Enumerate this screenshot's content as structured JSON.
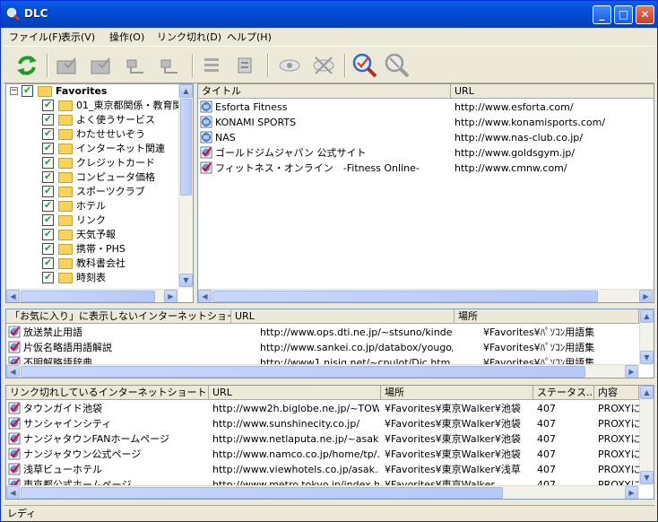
{
  "window": {
    "title": "DLC"
  },
  "menu": [
    "ファイル(F)",
    "表示(V)",
    "操作(O)",
    "リンク切れ(D)",
    "ヘルプ(H)"
  ],
  "tree": {
    "root": "Favorites",
    "items": [
      "01_東京都関係・教育関",
      "よく使うサービス",
      "わたせせいぞう",
      "インターネット関連",
      "クレジットカード",
      "コンピュータ価格",
      "スポーツクラブ",
      "ホテル",
      "リンク",
      "天気予報",
      "携帯・PHS",
      "教科書会社",
      "時刻表"
    ]
  },
  "list1": {
    "headers": [
      "タイトル",
      "URL"
    ],
    "rows": [
      [
        "Esforta Fitness",
        "http://www.esforta.com/"
      ],
      [
        "KONAMI SPORTS",
        "http://www.konamisports.com/"
      ],
      [
        "NAS",
        "http://www.nas-club.co.jp/"
      ],
      [
        "ゴールドジムジャパン 公式サイト",
        "http://www.goldsgym.jp/"
      ],
      [
        "フィットネス・オンライン　-Fitness Online-",
        "http://www.cmnw.com/"
      ]
    ]
  },
  "list2": {
    "headers": [
      "「お気に入り」に表示しないインターネットショートカ...",
      "URL",
      "場所"
    ],
    "rows": [
      [
        "放送禁止用語",
        "http://www.ops.dti.ne.jp/~stsuno/kindex.html",
        "¥Favorites¥ﾊﾟｿｺﾝ用語集"
      ],
      [
        "片仮名略語用語解説",
        "http://www.sankei.co.jp/databox/yougo/ryak...",
        "¥Favorites¥ﾊﾟｿｺﾝ用語集"
      ],
      [
        "不明解略語辞典",
        "http://www1.nisiq.net/~cpulot/Dic.htm",
        "¥Favorites¥ﾊﾟｿｺﾝ用語集"
      ]
    ]
  },
  "list3": {
    "headers": [
      "リンク切れしているインターネットショートカット",
      "URL",
      "場所",
      "ステータス...",
      "内容"
    ],
    "rows": [
      [
        "タウンガイド池袋",
        "http://www2h.biglobe.ne.jp/~TOW...",
        "¥Favorites¥東京Walker¥池袋",
        "407",
        "PROXYに"
      ],
      [
        "サンシャインシティ",
        "http://www.sunshinecity.co.jp/",
        "¥Favorites¥東京Walker¥池袋",
        "407",
        "PROXYに"
      ],
      [
        "ナンジャタウンFANホームページ",
        "http://www.netlaputa.ne.jp/~asaku...",
        "¥Favorites¥東京Walker¥池袋",
        "407",
        "PROXYに"
      ],
      [
        "ナンジャタウン公式ページ",
        "http://www.namco.co.jp/home/tp/...",
        "¥Favorites¥東京Walker¥池袋",
        "407",
        "PROXYに"
      ],
      [
        "浅草ビューホテル",
        "http://www.viewhotels.co.jp/asak...",
        "¥Favorites¥東京Walker¥浅草",
        "407",
        "PROXYに"
      ],
      [
        "東京都公式ホームページ",
        "http://www.metro.tokyo.jp/index.h...",
        "¥Favorites¥東京Walker",
        "407",
        "PROXYに"
      ]
    ]
  },
  "status": "レディ"
}
